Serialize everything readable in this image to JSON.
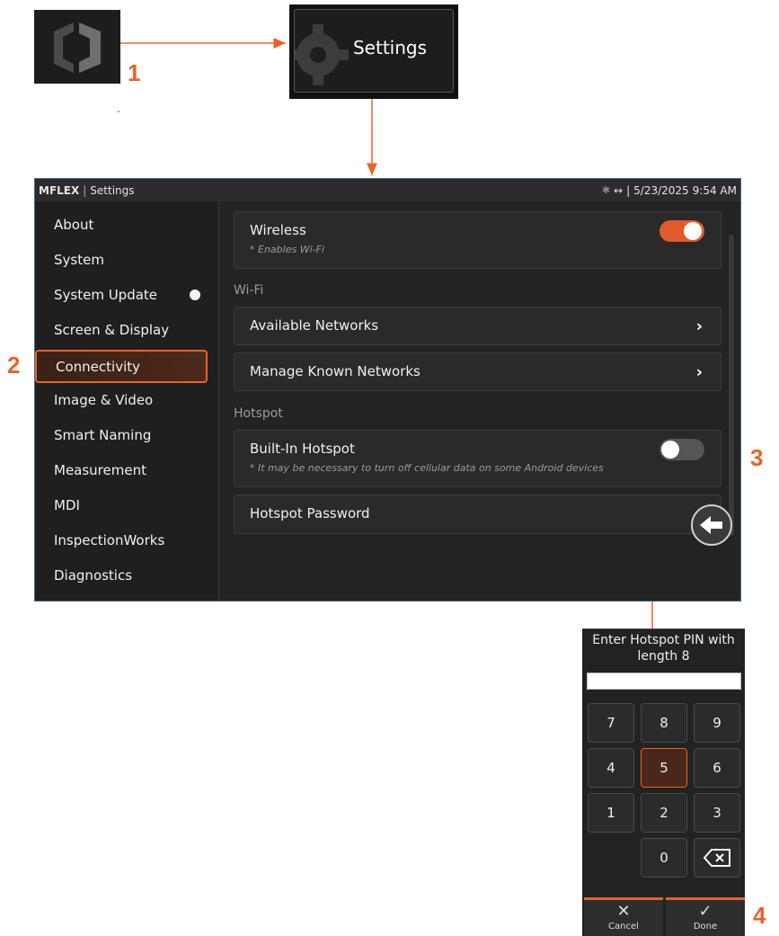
{
  "callouts": {
    "one": "1",
    "two": "2",
    "three": "3",
    "four": "4"
  },
  "settings_tile": {
    "label": "Settings"
  },
  "topbar": {
    "brand": "MFLEX",
    "separator": "|",
    "screen": "Settings",
    "transfer_icon": "↔",
    "date": "5/23/2025",
    "time": "9:54 AM"
  },
  "sidebar": {
    "items": [
      {
        "label": "About"
      },
      {
        "label": "System"
      },
      {
        "label": "System Update"
      },
      {
        "label": "Screen & Display"
      },
      {
        "label": "Connectivity"
      },
      {
        "label": "Image & Video"
      },
      {
        "label": "Smart Naming"
      },
      {
        "label": "Measurement"
      },
      {
        "label": "MDI"
      },
      {
        "label": "InspectionWorks"
      },
      {
        "label": "Diagnostics"
      }
    ],
    "active": "Connectivity"
  },
  "content": {
    "wireless": {
      "title": "Wireless",
      "note": "* Enables Wi-Fi",
      "enabled": true
    },
    "wifi_section": "Wi-Fi",
    "available_networks": "Available Networks",
    "manage_known": "Manage Known Networks",
    "hotspot_section": "Hotspot",
    "builtin_hotspot": {
      "title": "Built-In Hotspot",
      "note": "* It may be necessary to turn off cellular data on some Android devices",
      "enabled": false
    },
    "hotspot_password": "Hotspot Password"
  },
  "pin_dialog": {
    "prompt_line1": "Enter Hotspot PIN with",
    "prompt_line2": "length 8",
    "value": "",
    "keys": [
      "7",
      "8",
      "9",
      "4",
      "5",
      "6",
      "1",
      "2",
      "3",
      "0"
    ],
    "highlighted_key": "5",
    "cancel_label": "Cancel",
    "done_label": "Done"
  },
  "colors": {
    "accent": "#e8632a",
    "background": "#232323"
  }
}
